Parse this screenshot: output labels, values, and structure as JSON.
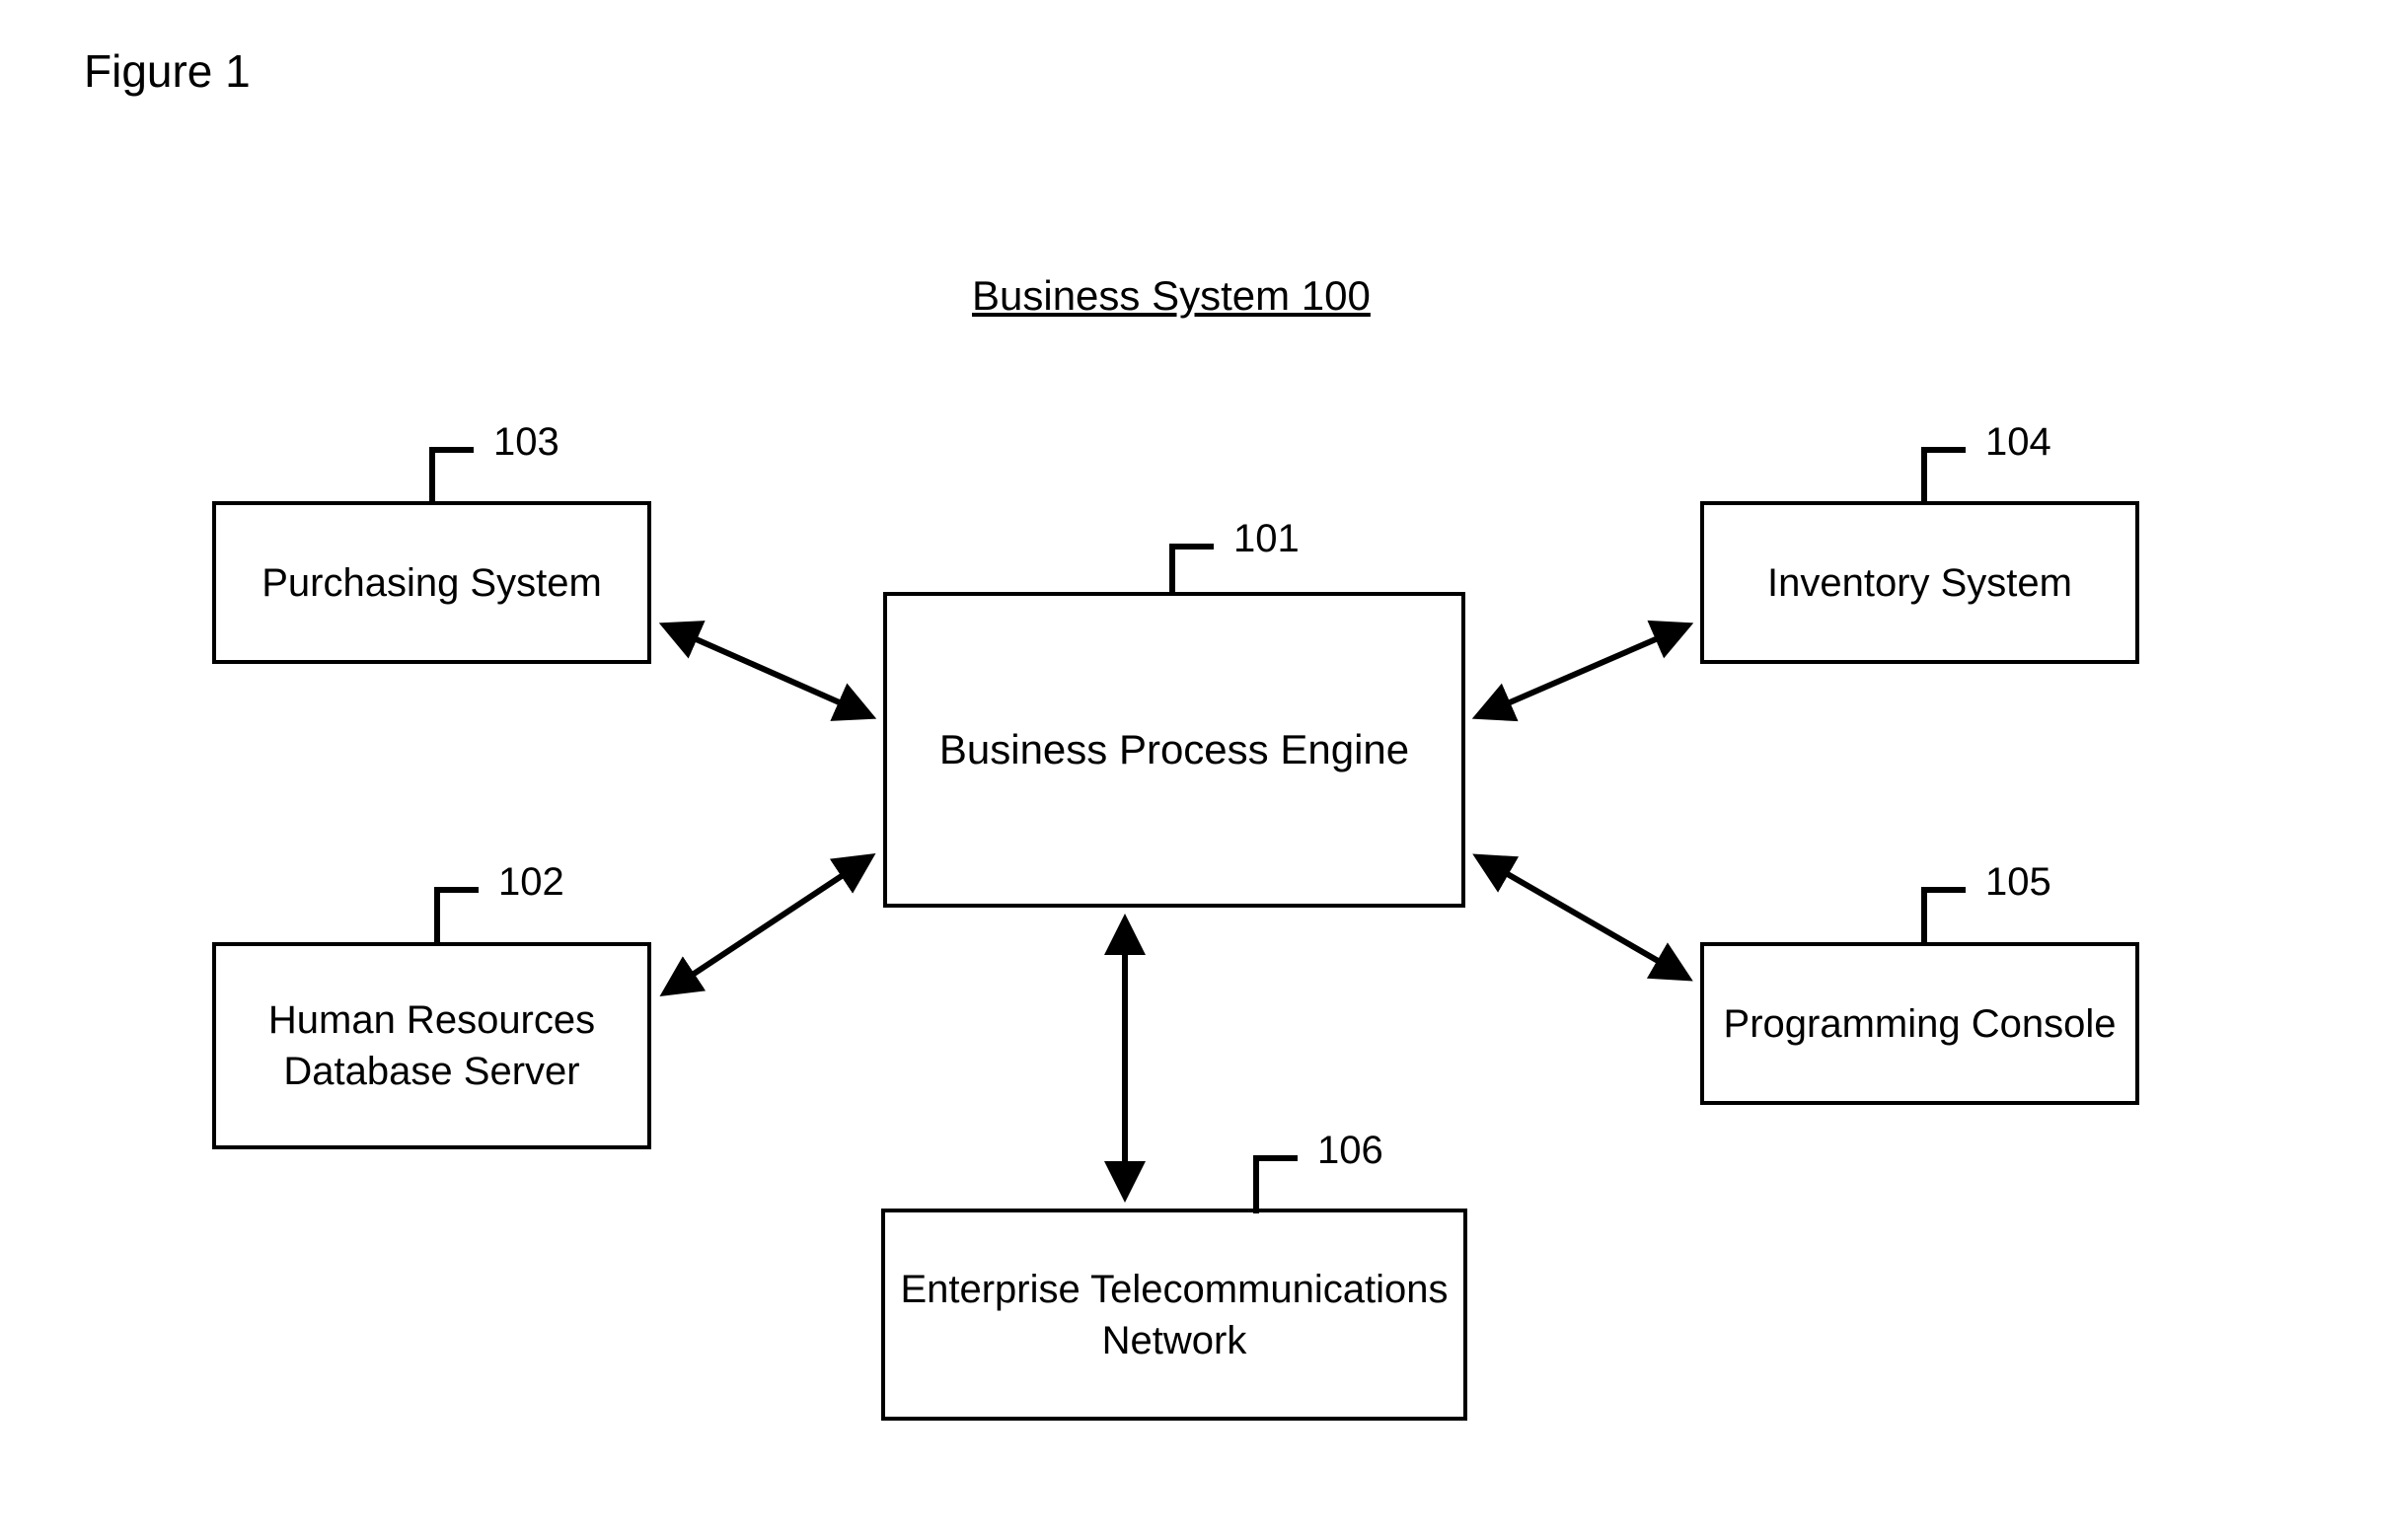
{
  "figure_label": "Figure 1",
  "title": "Business System 100",
  "boxes": {
    "center": {
      "label": "Business Process Engine",
      "ref": "101"
    },
    "top_left": {
      "label": "Purchasing System",
      "ref": "103"
    },
    "bottom_left": {
      "label": "Human Resources\nDatabase Server",
      "ref": "102"
    },
    "top_right": {
      "label": "Inventory System",
      "ref": "104"
    },
    "bottom_right": {
      "label": "Programming Console",
      "ref": "105"
    },
    "bottom_center": {
      "label": "Enterprise Telecommunications\nNetwork",
      "ref": "106"
    }
  }
}
